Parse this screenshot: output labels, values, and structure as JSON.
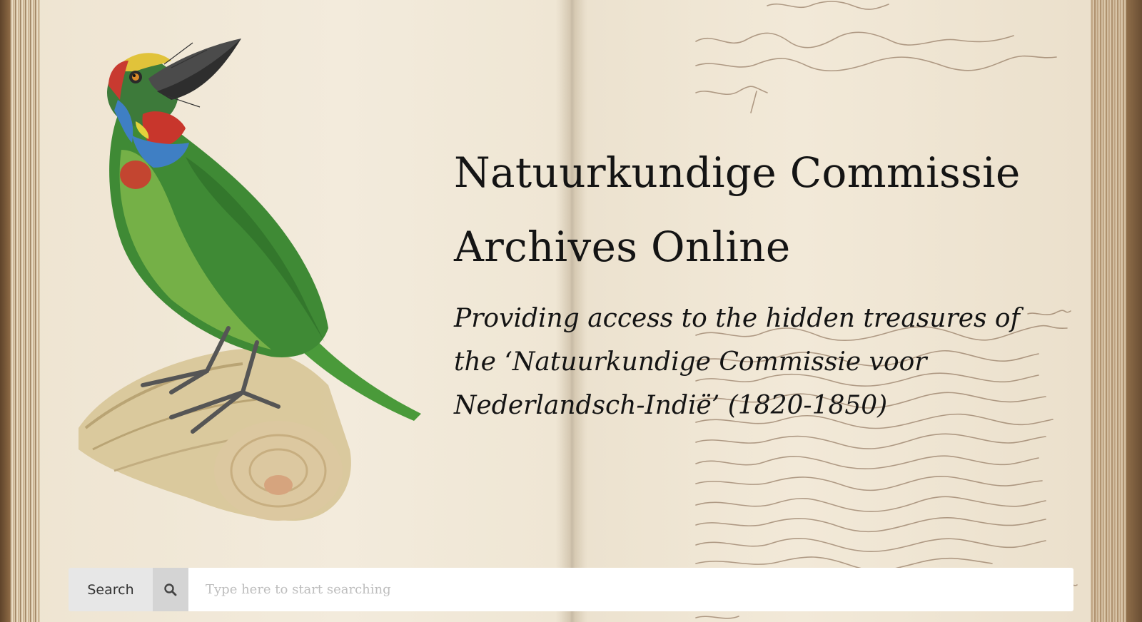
{
  "hero": {
    "title_line1": "Natuurkundige Commissie",
    "title_line2": "Archives Online",
    "subtitle": "Providing access to the hidden treasures of the ‘Natuurkundige Commissie voor Nederlandsch-Indië’ (1820-1850)"
  },
  "search": {
    "label": "Search",
    "icon": "search-icon",
    "placeholder": "Type here to start searching",
    "value": ""
  },
  "illustration": {
    "subject": "bird-illustration"
  },
  "colors": {
    "text": "#141414",
    "page": "#efe5d3",
    "ink": "#6b4e36",
    "bird_green": "#3f8a35",
    "search_label_bg": "#e7e7e7",
    "search_button_bg": "#d4d4d4"
  }
}
